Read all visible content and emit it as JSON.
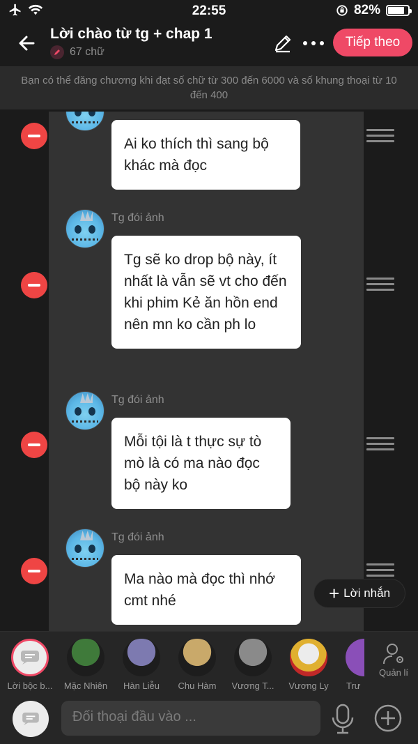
{
  "status_bar": {
    "time": "22:55",
    "battery": "82%",
    "battery_level": 0.82
  },
  "header": {
    "title": "Lời chào từ tg + chap 1",
    "word_count": "67 chữ",
    "next_label": "Tiếp theo"
  },
  "info": {
    "text": "Bạn có thể đăng chương khi đạt số chữ từ 300 đến 6000 và số khung thoại từ 10 đến 400"
  },
  "messages": [
    {
      "sender": "",
      "text": "Ai ko thích thì sang bộ khác mà đọc"
    },
    {
      "sender": "Tg đói ảnh",
      "text": "Tg sẽ ko drop bộ này, ít nhất là vẫn sẽ vt cho đến khi phim Kẻ ăn hồn end nên mn ko cần ph lo"
    },
    {
      "sender": "Tg đói ảnh",
      "text": "Mỗi tội là t thực sự tò mò là có ma nào đọc bộ này ko"
    },
    {
      "sender": "Tg đói ảnh",
      "text": "Ma nào mà đọc thì nhớ cmt nhé"
    }
  ],
  "add_message_label": "Lời nhắn",
  "characters": [
    {
      "name": "Lời bộc b...",
      "color": "#ececec"
    },
    {
      "name": "Mặc Nhiên",
      "color": "#3f7a3a"
    },
    {
      "name": "Hàn Liễu",
      "color": "#7d7ab0"
    },
    {
      "name": "Chu Hàm",
      "color": "#c9a96a"
    },
    {
      "name": "Vương T...",
      "color": "#8a8a8a"
    },
    {
      "name": "Vương Ly",
      "color": "#e0b030"
    },
    {
      "name": "Trư",
      "color": "#8a4fb8"
    }
  ],
  "manage_label": "Quản lí",
  "input": {
    "placeholder": "Đối thoại đầu vào ..."
  },
  "colors": {
    "accent": "#ef4966",
    "remove": "#ef4544"
  }
}
